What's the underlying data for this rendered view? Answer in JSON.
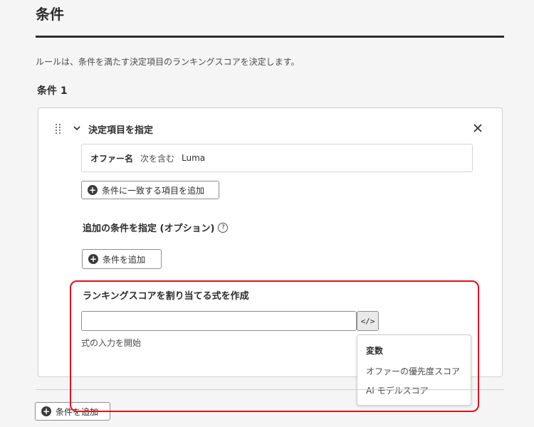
{
  "page": {
    "title": "条件",
    "description": "ルールは、条件を満たす決定項目のランキングスコアを決定します。"
  },
  "condition": {
    "heading": "条件 1",
    "section_title": "決定項目を指定",
    "filter": {
      "field": "オファー名",
      "operator": "次を含む",
      "value": "Luma"
    },
    "add_matching_item_label": "条件に一致する項目を追加",
    "optional_title": "追加の条件を指定 (オプション)",
    "help_icon": "?",
    "add_condition_label": "条件を追加"
  },
  "formula": {
    "title": "ランキングスコアを割り当てる式を作成",
    "input_value": "",
    "hint": "式の入力を開始",
    "code_button_label": "</>"
  },
  "variables_popover": {
    "heading": "変数",
    "items": [
      "オファーの優先度スコア",
      "AI モデルスコア"
    ]
  },
  "footer": {
    "add_condition_label": "条件を追加"
  },
  "colors": {
    "highlight": "#e3101d",
    "text": "#2c2c2c",
    "background": "#f5f5f5"
  },
  "icons": {
    "drag": "drag-handle-icon",
    "chevron": "chevron-down-icon",
    "close": "close-icon",
    "add": "add-circle-icon",
    "help": "help-icon",
    "code": "code-icon"
  }
}
